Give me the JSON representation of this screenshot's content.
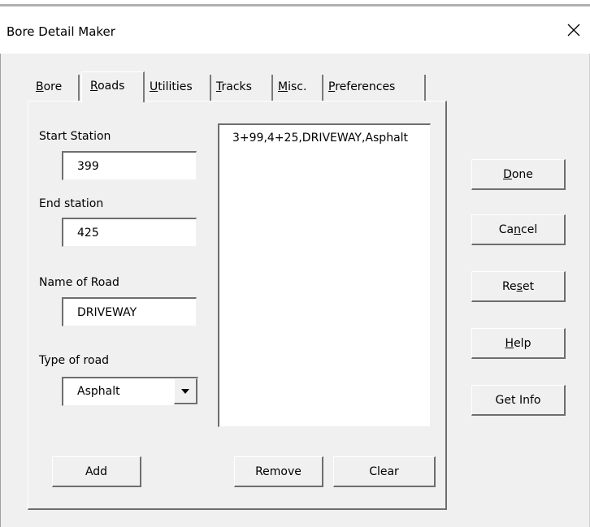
{
  "window": {
    "title": "Bore Detail Maker"
  },
  "tabs": [
    {
      "pre": "",
      "key": "B",
      "post": "ore"
    },
    {
      "pre": "",
      "key": "R",
      "post": "oads"
    },
    {
      "pre": "",
      "key": "U",
      "post": "tilities"
    },
    {
      "pre": "",
      "key": "T",
      "post": "racks"
    },
    {
      "pre": "",
      "key": "M",
      "post": "isc."
    },
    {
      "pre": "",
      "key": "P",
      "post": "references"
    }
  ],
  "active_tab": "Roads",
  "form": {
    "start_station_label": "Start Station",
    "start_station_value": "399",
    "end_station_label": "End station",
    "end_station_value": "425",
    "road_name_label": "Name of Road",
    "road_name_value": "DRIVEWAY",
    "road_type_label": "Type of road",
    "road_type_value": "Asphalt"
  },
  "list": {
    "items": [
      "3+99,4+25,DRIVEWAY,Asphalt"
    ]
  },
  "buttons": {
    "add": "Add",
    "remove": "Remove",
    "clear": "Clear",
    "done": {
      "pre": "",
      "key": "D",
      "post": "one"
    },
    "cancel": {
      "pre": "Ca",
      "key": "n",
      "post": "cel"
    },
    "reset": {
      "pre": "Re",
      "key": "s",
      "post": "et"
    },
    "help": {
      "pre": "",
      "key": "H",
      "post": "elp"
    },
    "get_info": "Get Info"
  },
  "icons": {
    "close": "close-icon",
    "dropdown": "chevron-down-icon"
  }
}
